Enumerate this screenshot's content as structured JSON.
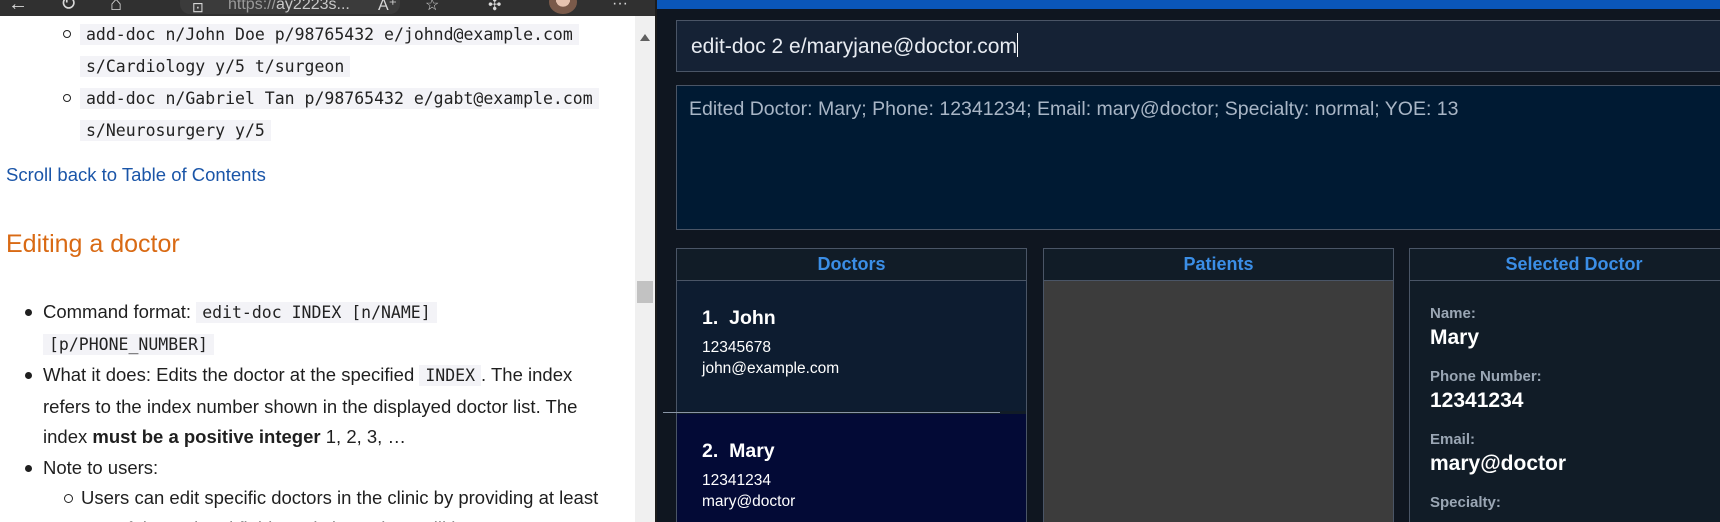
{
  "browser": {
    "url_visible": "https://",
    "url_rest": "ay2223s..."
  },
  "docs": {
    "examples": [
      {
        "line1": "add-doc n/John Doe p/98765432 e/johnd@example.com",
        "line2": "s/Cardiology y/5 t/surgeon"
      },
      {
        "line1": "add-doc n/Gabriel Tan p/98765432 e/gabt@example.com",
        "line2": "s/Neurosurgery y/5"
      }
    ],
    "scroll_link": "Scroll back to Table of Contents",
    "section_heading": "Editing a doctor",
    "command_format_label": "Command format: ",
    "command_format_code1": "edit-doc INDEX [n/NAME]",
    "command_format_code2": "[p/PHONE_NUMBER]",
    "what_it_does_prefix": "What it does: Edits the doctor at the specified ",
    "what_it_does_code": "INDEX",
    "what_it_does_mid": ". The index refers to the index number shown in the displayed doctor list. The index ",
    "what_it_does_bold": "must be a positive integer",
    "what_it_does_suffix": " 1, 2, 3, …",
    "note_label": "Note to users:",
    "note_sub": "Users can edit specific doctors in the clinic by providing at least one of the optional fields. Existing values will be"
  },
  "app": {
    "command_input": "edit-doc 2 e/maryjane@doctor.com",
    "result_text": "Edited Doctor: Mary; Phone: 12341234; Email: mary@doctor; Specialty: normal; YOE: 13",
    "panels": {
      "doctors": "Doctors",
      "patients": "Patients",
      "selected": "Selected Doctor"
    },
    "doctors": [
      {
        "index": "1.",
        "name": "John",
        "phone": "12345678",
        "email": "john@example.com"
      },
      {
        "index": "2.",
        "name": "Mary",
        "phone": "12341234",
        "email": "mary@doctor"
      }
    ],
    "selected": {
      "name_label": "Name:",
      "name": "Mary",
      "phone_label": "Phone Number:",
      "phone": "12341234",
      "email_label": "Email:",
      "email": "mary@doctor",
      "specialty_label": "Specialty:"
    }
  },
  "colors": {
    "app_bg": "#0f1620",
    "accent_blue": "#3b8ee6",
    "heading_orange": "#d96a14",
    "link_blue": "#1a55a8"
  }
}
